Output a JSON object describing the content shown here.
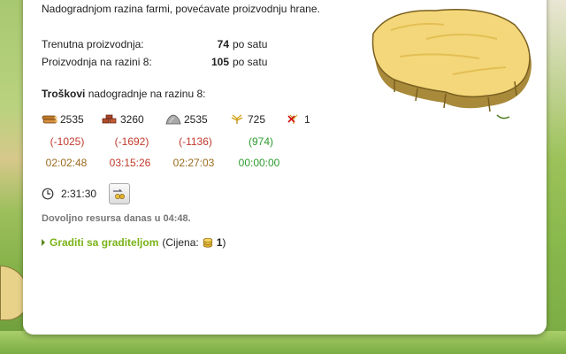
{
  "intro_text": "Nadogradnjom razina farmi, povećavate proizvodnju hrane.",
  "production": {
    "current_label": "Trenutna proizvodnja:",
    "current_value": "74",
    "current_unit": "po satu",
    "next_label": "Proizvodnja na razini 8:",
    "next_value": "105",
    "next_unit": "po satu"
  },
  "costs": {
    "title_bold": "Troškovi",
    "title_rest": " nadogradnje na razinu 8:",
    "resources": [
      {
        "icon": "wood-icon",
        "amount": "2535",
        "diff": "(-1025)",
        "time": "02:02:48"
      },
      {
        "icon": "clay-icon",
        "amount": "3260",
        "diff": "(-1692)",
        "time": "03:15:26"
      },
      {
        "icon": "iron-icon",
        "amount": "2535",
        "diff": "(-1136)",
        "time": "02:27:03"
      },
      {
        "icon": "crop-icon",
        "amount": "725",
        "diff": "(974)",
        "time": "00:00:00"
      },
      {
        "icon": "crop-consumption-icon",
        "amount": "1"
      }
    ]
  },
  "build_time": "2:31:30",
  "enough_resources_text": "Dovoljno resursa danas u 04:48.",
  "builder": {
    "link_label": "Graditi sa graditeljom",
    "price_open": "(Cijena:",
    "price_value": "1",
    "price_close": ")"
  },
  "colors": {
    "deficit": "#c0392b",
    "surplus": "#2e9b2e",
    "time_pending": "#9a6a1b",
    "link": "#7ab318"
  }
}
